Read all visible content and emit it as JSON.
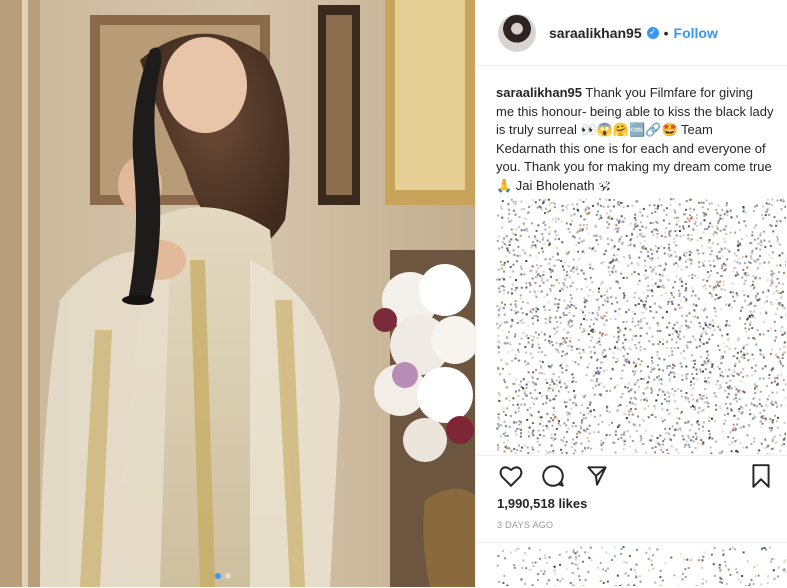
{
  "post": {
    "username": "saraalikhan95",
    "verified_icon": "verified-badge-icon",
    "separator": "•",
    "follow_label": "Follow",
    "caption_user": "saraalikhan95",
    "caption_text": " Thank you Filmfare for giving me this honour- being able to kiss the black lady is truly surreal 👀😱🤗🆒🔗🤩 Team Kedarnath this one is for each and everyone of you. Thank you for making my dream come true 🙏 Jai Bholenath 🕉",
    "likes": "1,990,518 likes",
    "timestamp": "3 DAYS AGO",
    "carousel_next_icon": "chevron-right-icon",
    "accent_color": "#3897f0"
  }
}
